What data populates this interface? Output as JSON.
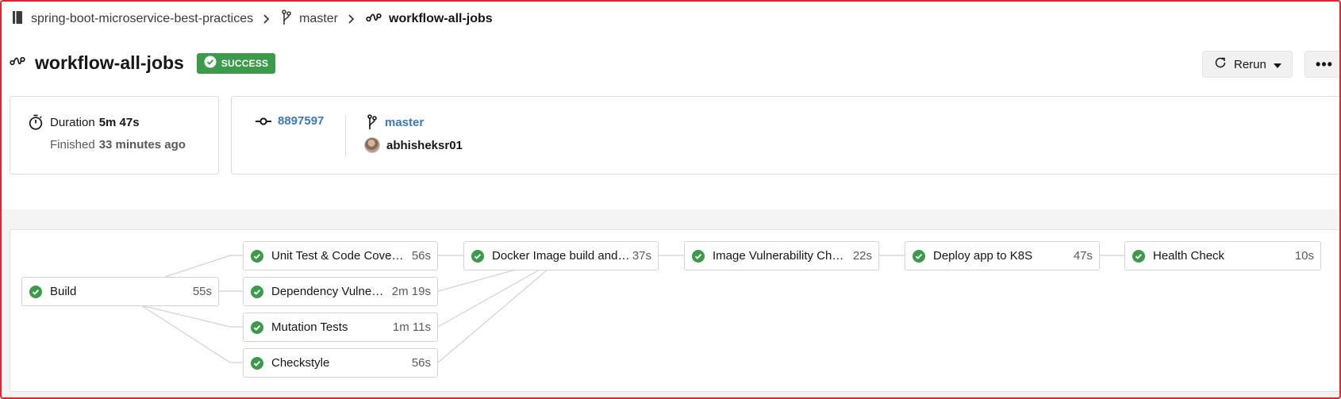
{
  "breadcrumb": {
    "project": "spring-boot-microservice-best-practices",
    "branch": "master",
    "workflow": "workflow-all-jobs"
  },
  "header": {
    "title": "workflow-all-jobs",
    "status": "SUCCESS",
    "rerun_label": "Rerun",
    "more_label": "•••"
  },
  "duration_card": {
    "duration_label": "Duration",
    "duration_value": "5m 47s",
    "finished_label": "Finished",
    "finished_value": "33 minutes ago"
  },
  "commit_card": {
    "commit_hash": "8897597",
    "branch": "master",
    "author": "abhisheksr01"
  },
  "pipeline": {
    "jobs": [
      {
        "name": "Build",
        "duration": "55s",
        "status": "success"
      },
      {
        "name": "Unit Test & Code Coverage",
        "duration": "56s",
        "status": "success"
      },
      {
        "name": "Dependency Vulnera…",
        "duration": "2m 19s",
        "status": "success"
      },
      {
        "name": "Mutation Tests",
        "duration": "1m 11s",
        "status": "success"
      },
      {
        "name": "Checkstyle",
        "duration": "56s",
        "status": "success"
      },
      {
        "name": "Docker Image build and p…",
        "duration": "37s",
        "status": "success"
      },
      {
        "name": "Image Vulnerability Check",
        "duration": "22s",
        "status": "success"
      },
      {
        "name": "Deploy app to K8S",
        "duration": "47s",
        "status": "success"
      },
      {
        "name": "Health Check",
        "duration": "10s",
        "status": "success"
      }
    ]
  },
  "colors": {
    "success": "#3c9b4b",
    "link": "#3c78c0",
    "frame_border": "#e1262a"
  }
}
